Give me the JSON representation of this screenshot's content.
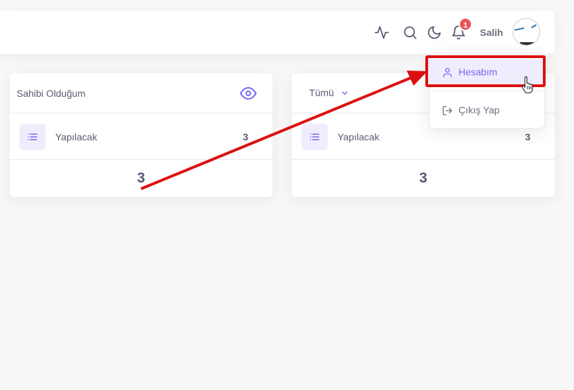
{
  "header": {
    "username": "Salih",
    "notification_count": "1"
  },
  "cards": [
    {
      "title": "Sahibi Olduğum",
      "row": {
        "label": "Yapılacak",
        "count": "3"
      },
      "total": "3"
    },
    {
      "dropdown_label": "Tümü",
      "row": {
        "label": "Yapılacak",
        "count": "3"
      },
      "total": "3"
    }
  ],
  "user_menu": {
    "account_label": "Hesabım",
    "logout_label": "Çıkış Yap"
  },
  "colors": {
    "primary": "#7367f0",
    "primary_light": "#efedfd",
    "danger": "#ea5455",
    "annotation_red": "#dc1010",
    "text": "#5e5873"
  }
}
